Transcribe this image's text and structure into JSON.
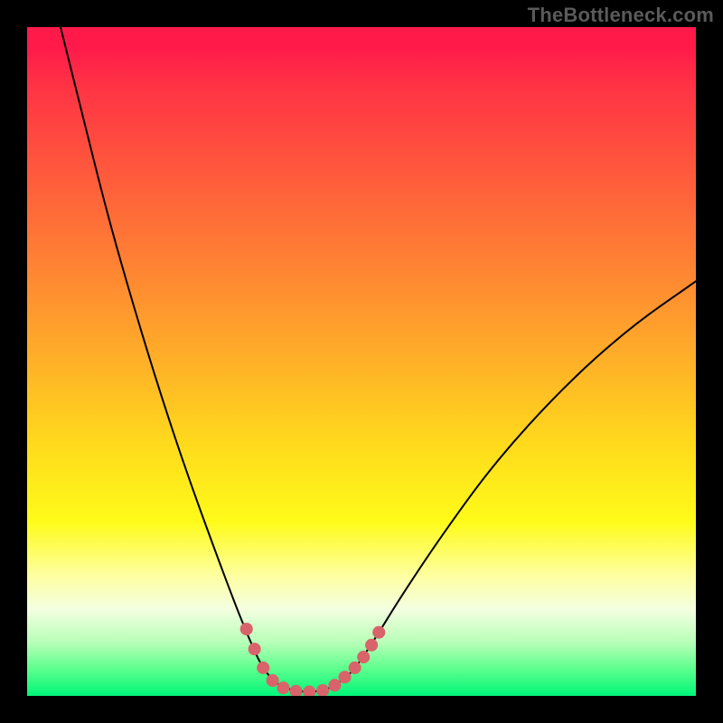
{
  "watermark": "TheBottleneck.com",
  "colors": {
    "marker": "#d9636a",
    "curve": "#000000"
  },
  "chart_data": {
    "type": "line",
    "title": "",
    "xlabel": "",
    "ylabel": "",
    "x_range": [
      0,
      100
    ],
    "y_range": [
      0,
      100
    ],
    "curve": [
      {
        "x": 5.0,
        "y": 100.0
      },
      {
        "x": 8.0,
        "y": 88.0
      },
      {
        "x": 12.0,
        "y": 72.0
      },
      {
        "x": 16.0,
        "y": 58.0
      },
      {
        "x": 20.0,
        "y": 45.0
      },
      {
        "x": 24.0,
        "y": 33.0
      },
      {
        "x": 28.0,
        "y": 22.0
      },
      {
        "x": 31.0,
        "y": 14.0
      },
      {
        "x": 33.0,
        "y": 9.0
      },
      {
        "x": 35.0,
        "y": 4.5
      },
      {
        "x": 37.0,
        "y": 2.0
      },
      {
        "x": 39.0,
        "y": 1.0
      },
      {
        "x": 41.0,
        "y": 0.6
      },
      {
        "x": 43.0,
        "y": 0.6
      },
      {
        "x": 45.0,
        "y": 1.0
      },
      {
        "x": 47.0,
        "y": 2.2
      },
      {
        "x": 49.0,
        "y": 4.0
      },
      {
        "x": 52.0,
        "y": 8.5
      },
      {
        "x": 56.0,
        "y": 15.0
      },
      {
        "x": 62.0,
        "y": 24.0
      },
      {
        "x": 70.0,
        "y": 35.0
      },
      {
        "x": 80.0,
        "y": 46.0
      },
      {
        "x": 90.0,
        "y": 55.0
      },
      {
        "x": 100.0,
        "y": 62.0
      }
    ],
    "markers": [
      {
        "x": 32.8,
        "y": 10.0
      },
      {
        "x": 34.0,
        "y": 7.0
      },
      {
        "x": 35.3,
        "y": 4.2
      },
      {
        "x": 36.7,
        "y": 2.3
      },
      {
        "x": 38.3,
        "y": 1.2
      },
      {
        "x": 40.2,
        "y": 0.7
      },
      {
        "x": 42.2,
        "y": 0.6
      },
      {
        "x": 44.2,
        "y": 0.8
      },
      {
        "x": 46.0,
        "y": 1.6
      },
      {
        "x": 47.5,
        "y": 2.8
      },
      {
        "x": 49.0,
        "y": 4.2
      },
      {
        "x": 50.3,
        "y": 5.8
      },
      {
        "x": 51.5,
        "y": 7.6
      },
      {
        "x": 52.6,
        "y": 9.5
      }
    ],
    "marker_radius_pct": 0.95
  }
}
